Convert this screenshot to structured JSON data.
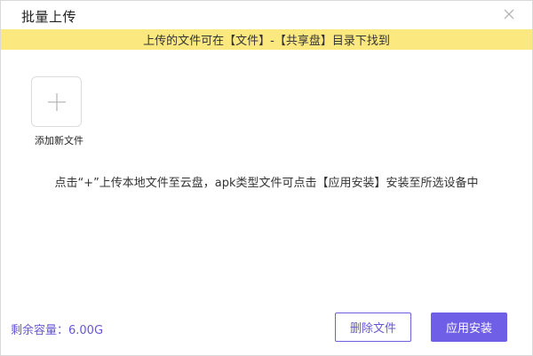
{
  "window": {
    "title": "批量上传"
  },
  "notice": {
    "text": "上传的文件可在【文件】-【共享盘】目录下找到"
  },
  "upload": {
    "add_label": "添加新文件",
    "hint": "点击“+”上传本地文件至云盘，apk类型文件可点击【应用安装】安装至所选设备中"
  },
  "footer": {
    "storage": "剩余容量：6.00G",
    "delete_label": "删除文件",
    "install_label": "应用安装"
  },
  "icons": {
    "close": "close-icon",
    "add": "plus-icon"
  },
  "colors": {
    "accent": "#6f5fe6",
    "notice_bg": "#fbe97f"
  }
}
